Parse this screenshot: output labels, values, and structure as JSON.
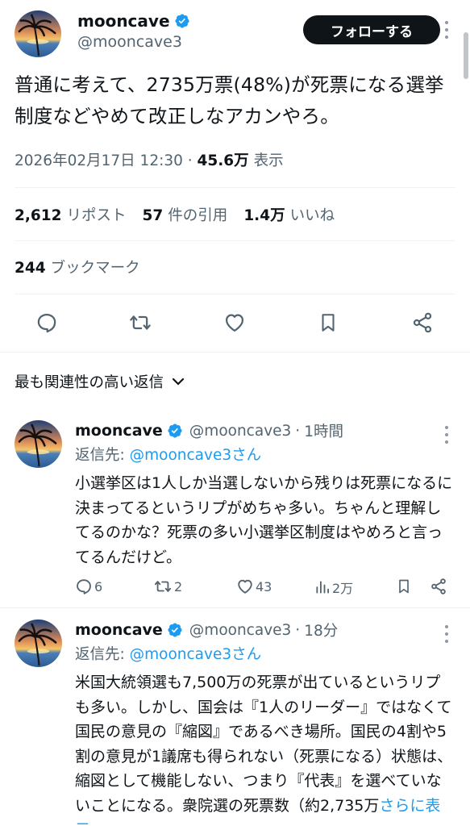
{
  "colors": {
    "accent": "#1d9bf0",
    "text": "#0f1419",
    "secondary": "#536471",
    "divider": "#eff3f4",
    "follow_bg": "#0f1419"
  },
  "main_tweet": {
    "author_name": "mooncave",
    "author_handle": "@mooncave3",
    "follow_label": "フォローする",
    "text": "普通に考えて、2735万票(48%)が死票になる選挙制度などやめて改正しなアカンやろ。",
    "timestamp": "2026年02月17日 12:30",
    "views_count": "45.6万",
    "views_label": "表示",
    "reposts_count": "2,612",
    "reposts_label": "リポスト",
    "quotes_count": "57",
    "quotes_label": "件の引用",
    "likes_count": "1.4万",
    "likes_label": "いいね",
    "bookmarks_count": "244",
    "bookmarks_label": "ブックマーク"
  },
  "sort_label": "最も関連性の高い返信",
  "replies": [
    {
      "author_name": "mooncave",
      "author_handle": "@mooncave3",
      "time": "1時間",
      "reply_to_prefix": "返信先:",
      "reply_to_handle": "@mooncave3さん",
      "text": "小選挙区は1人しか当選しないから残りは死票になるに決まってるというリプがめちゃ多い。ちゃんと理解してるのかな？死票の多い小選挙区制度はやめろと言ってるんだけど。",
      "replies": "6",
      "reposts": "2",
      "likes": "43",
      "views": "2万"
    },
    {
      "author_name": "mooncave",
      "author_handle": "@mooncave3",
      "time": "18分",
      "reply_to_prefix": "返信先:",
      "reply_to_handle": "@mooncave3さん",
      "text": "米国大統領選も7,500万の死票が出ているというリプも多い。しかし、国会は『1人のリーダー』ではなくて国民の意見の『縮図』であるべき場所。国民の4割や5割の意見が1議席も得られない（死票になる）状態は、縮図として機能しない、つまり『代表』を選べていないことになる。衆院選の死票数（約2,735万",
      "more_label": "さらに表示"
    }
  ]
}
